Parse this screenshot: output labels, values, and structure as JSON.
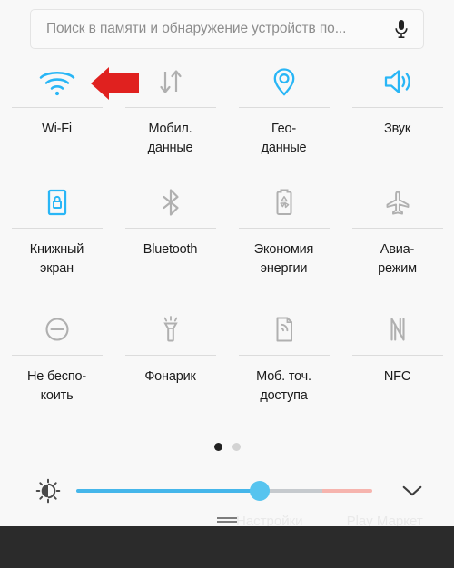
{
  "search": {
    "placeholder": "Поиск в памяти и обнаружение устройств по...",
    "mic_icon": "microphone-icon"
  },
  "tiles": [
    [
      {
        "label": "Wi-Fi",
        "icon": "wifi-icon",
        "active": true,
        "annotated": true
      },
      {
        "label": "Мобил.\nданные",
        "icon": "mobile-data-icon",
        "active": false
      },
      {
        "label": "Гео-\nданные",
        "icon": "location-pin-icon",
        "active": true
      },
      {
        "label": "Звук",
        "icon": "sound-speaker-icon",
        "active": true
      }
    ],
    [
      {
        "label": "Книжный\nэкран",
        "icon": "rotation-lock-icon",
        "active": true
      },
      {
        "label": "Bluetooth",
        "icon": "bluetooth-icon",
        "active": false
      },
      {
        "label": "Экономия\nэнергии",
        "icon": "battery-saver-icon",
        "active": false
      },
      {
        "label": "Авиа-\nрежим",
        "icon": "airplane-mode-icon",
        "active": false
      }
    ],
    [
      {
        "label": "Не беспо-\nкоить",
        "icon": "do-not-disturb-icon",
        "active": false
      },
      {
        "label": "Фонарик",
        "icon": "flashlight-icon",
        "active": false
      },
      {
        "label": "Моб. точ.\nдоступа",
        "icon": "hotspot-icon",
        "active": false
      },
      {
        "label": "NFC",
        "icon": "nfc-icon",
        "active": false
      }
    ]
  ],
  "pager": {
    "pages": 2,
    "current_page": 1
  },
  "brightness": {
    "icon": "auto-brightness-icon",
    "value_percent": 62,
    "gray_segment_percent": 21,
    "warn_segment_percent": 17,
    "expand_icon": "chevron-down-icon"
  },
  "drag_handle": "panel-drag-handle",
  "home_labels": [
    "Настройки",
    "Play Маркет"
  ],
  "colors": {
    "accent_active": "#29b6f6",
    "icon_inactive": "#b0b0b0",
    "panel_bg": "#f8f8f8",
    "navbar_bg": "#2b2b2b",
    "annotation_arrow": "#e0211f",
    "slider_fill": "#45b6ea",
    "slider_thumb": "#57c4ef",
    "slider_gray": "#c6cace",
    "slider_warn": "#f6b4ae"
  },
  "annotation": {
    "type": "arrow-left",
    "points_at": "Wi-Fi",
    "color": "#e0211f"
  }
}
